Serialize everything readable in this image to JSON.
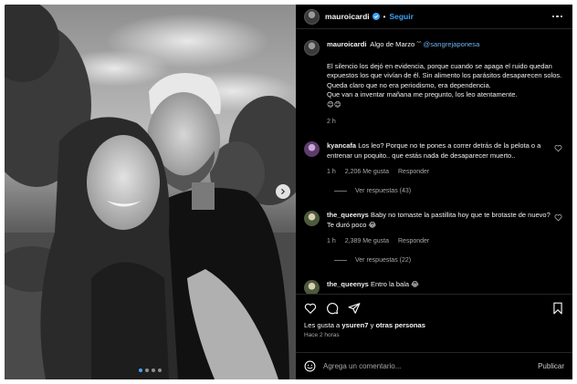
{
  "post": {
    "username": "mauroicardi",
    "follow_label": "Seguir",
    "separator": "•",
    "caption": {
      "username": "mauroicardi",
      "lead": "Algo de Marzo ˆˆ",
      "mention": "@sangrejaponesa",
      "text": "El silencio los dejó en evidencia, porque cuando se apaga el ruido quedan expuestos los que vivían de él. Sin alimento los parásitos desaparecen solos.\nQueda claro que no era periodismo, era dependencia.\nQue van a inventar mañana me pregunto, los leo atentamente.\n😊😊",
      "age": "2 h"
    },
    "comments": [
      {
        "username": "kyancafa",
        "text": "Los leo? Porque no te pones a correr detrás de la pelota o a entrenar un poquito.. que estás nada de desaparecer muerto..",
        "age": "1 h",
        "likes": "2,206 Me gusta",
        "reply_label": "Responder",
        "view_replies": "Ver respuestas (43)"
      },
      {
        "username": "the_queenys",
        "text": "Baby no tomaste la pastillita hoy que te brotaste de nuevo? Te duró poco 😂",
        "age": "1 h",
        "likes": "2,389 Me gusta",
        "reply_label": "Responder",
        "view_replies": "Ver respuestas (22)"
      },
      {
        "username": "the_queenys",
        "text": "Entro la bala 😂"
      }
    ],
    "likes_text_prefix": "Les gusta a ",
    "likes_user": "ysuren7",
    "likes_text_mid": " y ",
    "likes_others": "otras personas",
    "time_ago": "Hace 2 horas",
    "comment_placeholder": "Agrega un comentario...",
    "publish_label": "Publicar",
    "carousel": {
      "count": 4,
      "active_index": 0
    }
  },
  "icons": {
    "verified": "verified-badge-icon",
    "more": "more-options-icon",
    "like": "heart-icon",
    "comment": "comment-icon",
    "share": "share-icon",
    "save": "bookmark-icon",
    "emoji": "emoji-icon",
    "next": "chevron-right-icon"
  },
  "colors": {
    "accent": "#3ea2f5",
    "background": "#000000",
    "muted": "#a8a8a8"
  }
}
